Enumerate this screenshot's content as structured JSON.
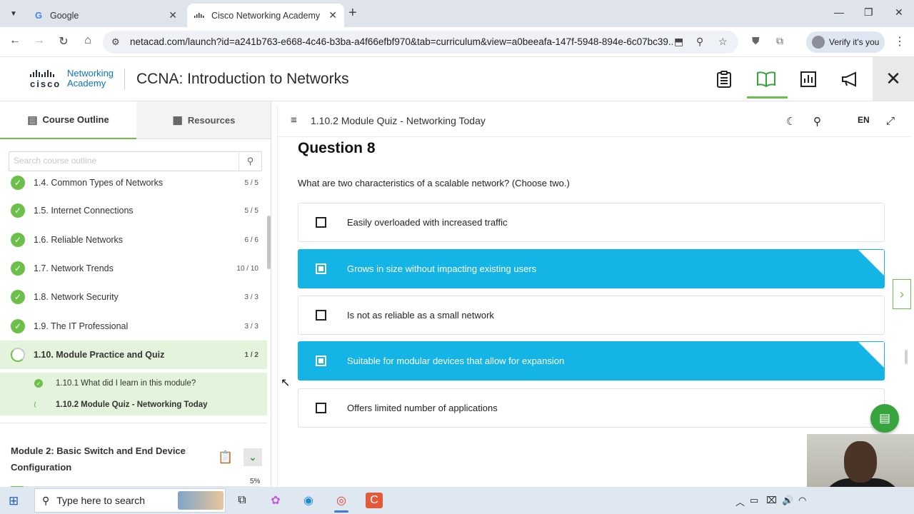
{
  "browser": {
    "tabs": [
      {
        "title": "Google",
        "favicon": "google-icon",
        "active": false
      },
      {
        "title": "Cisco Networking Academy",
        "favicon": "cisco-icon",
        "active": true
      }
    ],
    "url": "netacad.com/launch?id=a241b763-e668-4c46-b3ba-a4f66efbf970&tab=curriculum&view=a0beeafa-147f-5948-894e-6c07bc39...",
    "verify_label": "Verify it's you"
  },
  "app": {
    "logo_text": "Networking Academy",
    "logo_brand": "cisco",
    "logo_line1": "Networking",
    "logo_line2": "Academy",
    "course_title": "CCNA: Introduction to Networks",
    "header_icons": [
      "clipboard-icon",
      "book-icon",
      "chart-icon",
      "megaphone-icon",
      "close-icon"
    ],
    "active_header_icon": "book-icon"
  },
  "sidebar": {
    "tabs": [
      {
        "label": "Course Outline",
        "icon": "outline-icon",
        "active": true
      },
      {
        "label": "Resources",
        "icon": "document-icon",
        "active": false
      }
    ],
    "search_placeholder": "Search course outline",
    "items": [
      {
        "label": "1.4. Common Types of Networks",
        "count": "5 / 5",
        "status": "complete"
      },
      {
        "label": "1.5. Internet Connections",
        "count": "5 / 5",
        "status": "complete"
      },
      {
        "label": "1.6. Reliable Networks",
        "count": "6 / 6",
        "status": "complete"
      },
      {
        "label": "1.7. Network Trends",
        "count": "10 / 10",
        "status": "complete"
      },
      {
        "label": "1.8. Network Security",
        "count": "3 / 3",
        "status": "complete"
      },
      {
        "label": "1.9. The IT Professional",
        "count": "3 / 3",
        "status": "complete"
      },
      {
        "label": "1.10. Module Practice and Quiz",
        "count": "1 / 2",
        "status": "in-progress"
      }
    ],
    "subitems": [
      {
        "label": "1.10.1 What did I learn in this module?",
        "status": "complete"
      },
      {
        "label": "1.10.2 Module Quiz - Networking Today",
        "status": "in-progress"
      }
    ],
    "next_module": {
      "title": "Module 2: Basic Switch and End Device Configuration",
      "progress_label": "5%",
      "progress": 0.05
    }
  },
  "main": {
    "breadcrumb": "1.10.2 Module Quiz - Networking Today",
    "language": "EN",
    "question_number": "Question 8",
    "question_text": "What are two characteristics of a scalable network? (Choose two.)",
    "options": [
      {
        "text": "Easily overloaded with increased traffic",
        "selected": false
      },
      {
        "text": "Grows in size without impacting existing users",
        "selected": true
      },
      {
        "text": "Is not as reliable as a small network",
        "selected": false
      },
      {
        "text": "Suitable for modular devices that allow for expansion",
        "selected": true
      },
      {
        "text": "Offers limited number of applications",
        "selected": false
      }
    ]
  },
  "taskbar": {
    "search_placeholder": "Type here to search"
  },
  "colors": {
    "accent_green": "#6cc04a",
    "selected_blue": "#14b4e6",
    "cisco_blue": "#0b76b8"
  }
}
